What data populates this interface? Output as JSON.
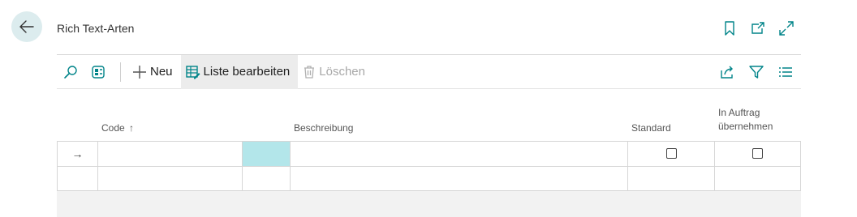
{
  "page": {
    "title": "Rich Text-Arten",
    "back_icon": "arrow-left-icon",
    "top_icons": [
      "bookmark-icon",
      "open-new-window-icon",
      "expand-icon"
    ]
  },
  "toolbar": {
    "search_icon": "search-icon",
    "filter_pane_icon": "filter-pane-icon",
    "new_label": "Neu",
    "edit_list_label": "Liste bearbeiten",
    "delete_label": "Löschen",
    "right_icons": [
      "share-icon",
      "filter-icon",
      "list-view-icon"
    ]
  },
  "columns": {
    "code": "Code",
    "code_sort": "↑",
    "description": "Beschreibung",
    "standard": "Standard",
    "in_order_line1": "In Auftrag",
    "in_order_line2": "übernehmen"
  },
  "rows": [
    {
      "code": "",
      "description": "",
      "standard": false,
      "in_order": false
    },
    {
      "code": "",
      "description": "",
      "standard": null,
      "in_order": null
    }
  ],
  "row_indicator": "→",
  "colors": {
    "accent": "#008489",
    "selected_cell": "#b3e6ea",
    "back_button_bg": "#dcecee"
  }
}
